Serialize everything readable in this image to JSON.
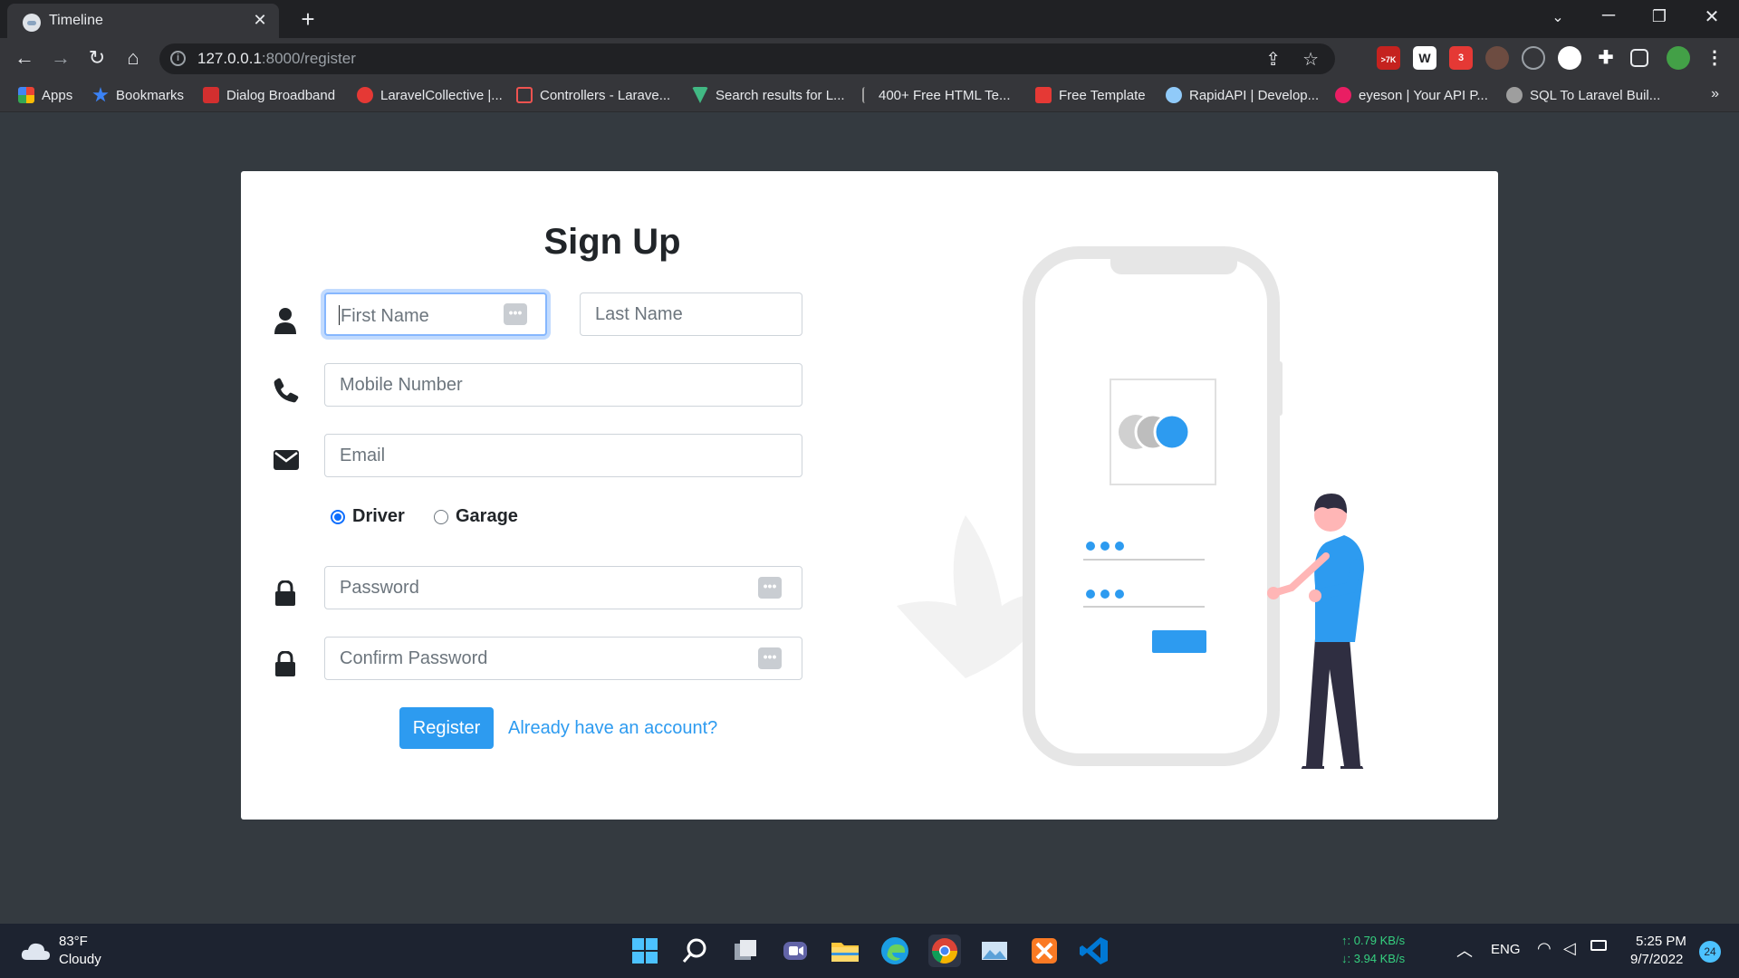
{
  "browser": {
    "tab_title": "Timeline",
    "tab_close": "✕",
    "new_tab": "+",
    "url_host": "127.0.0.1",
    "url_rest": ":8000/register",
    "ext_badge_gmail": ">7K",
    "ext_badge_s": "3",
    "ext_w": "W",
    "bookmarks": [
      {
        "label": "Apps",
        "color": "#4285f4"
      },
      {
        "label": "Bookmarks",
        "color": "#3b82f6"
      },
      {
        "label": "Dialog Broadband",
        "color": "#d32f2f"
      },
      {
        "label": "LaravelCollective |...",
        "color": "#e53935"
      },
      {
        "label": "Controllers - Larave...",
        "color": "#ef5350"
      },
      {
        "label": "Search results for L...",
        "color": "#41b883"
      },
      {
        "label": "400+ Free HTML Te...",
        "color": "#9e9e9e"
      },
      {
        "label": "Free Template",
        "color": "#e53935"
      },
      {
        "label": "RapidAPI | Develop...",
        "color": "#90caf9"
      },
      {
        "label": "eyeson | Your API P...",
        "color": "#e91e63"
      },
      {
        "label": "SQL To Laravel Buil...",
        "color": "#9e9e9e"
      }
    ],
    "bookmarks_more": "»"
  },
  "form": {
    "title": "Sign Up",
    "first_name_placeholder": "First Name",
    "last_name_placeholder": "Last Name",
    "mobile_placeholder": "Mobile Number",
    "email_placeholder": "Email",
    "role_options": [
      {
        "label": "Driver",
        "checked": true
      },
      {
        "label": "Garage",
        "checked": false
      }
    ],
    "password_placeholder": "Password",
    "confirm_password_placeholder": "Confirm Password",
    "register_label": "Register",
    "login_link": "Already have an account?",
    "accent_color": "#2d9bf0"
  },
  "taskbar": {
    "weather_temp": "83°F",
    "weather_desc": "Cloudy",
    "net_up": "↑: 0.79 KB/s",
    "net_down": "↓: 3.94 KB/s",
    "lang": "ENG",
    "time": "5:25 PM",
    "date": "9/7/2022",
    "notif_count": "24"
  }
}
